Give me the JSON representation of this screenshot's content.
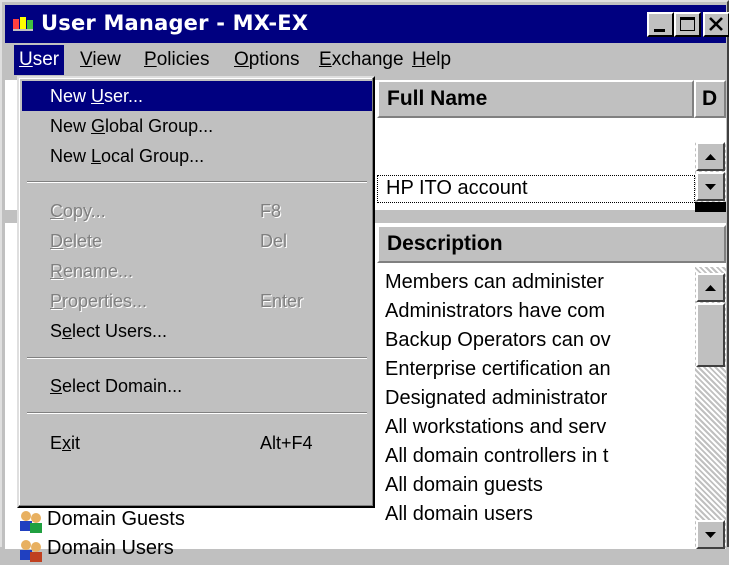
{
  "window": {
    "title": "User Manager - MX-EX"
  },
  "menubar": [
    {
      "label": "User",
      "mnemonic": "U",
      "rest": "ser"
    },
    {
      "label": "View",
      "mnemonic": "V",
      "rest": "iew"
    },
    {
      "label": "Policies",
      "mnemonic": "P",
      "rest": "olicies"
    },
    {
      "label": "Options",
      "mnemonic": "O",
      "rest": "ptions"
    },
    {
      "label": "Exchange",
      "mnemonic": "E",
      "rest": "xchange"
    },
    {
      "label": "Help",
      "mnemonic": "H",
      "rest": "elp"
    }
  ],
  "user_menu": {
    "new_user": {
      "pre": "New ",
      "mn": "U",
      "post": "ser..."
    },
    "new_global_group": {
      "pre": "New ",
      "mn": "G",
      "post": "lobal Group..."
    },
    "new_local_group": {
      "pre": "New ",
      "mn": "L",
      "post": "ocal Group..."
    },
    "copy": {
      "pre": "",
      "mn": "C",
      "post": "opy...",
      "shortcut": "F8"
    },
    "delete": {
      "pre": "",
      "mn": "D",
      "post": "elete",
      "shortcut": "Del"
    },
    "rename": {
      "pre": "",
      "mn": "R",
      "post": "ename..."
    },
    "properties": {
      "pre": "",
      "mn": "P",
      "post": "roperties...",
      "shortcut": "Enter"
    },
    "select_users": {
      "pre": "S",
      "mn": "e",
      "post": "lect Users..."
    },
    "select_domain": {
      "pre": "",
      "mn": "S",
      "post": "elect Domain..."
    },
    "exit": {
      "pre": "E",
      "mn": "x",
      "post": "it",
      "shortcut": "Alt+F4"
    }
  },
  "users_pane": {
    "column_full_name": "Full Name",
    "column_partial": "D",
    "rows": [
      "HP ITO account"
    ]
  },
  "groups_pane": {
    "column_description": "Description",
    "descriptions": [
      "Members can administer",
      "Administrators have com",
      "Backup Operators can ov",
      "Enterprise certification an",
      "Designated administrator",
      "All workstations and serv",
      "All domain controllers in t",
      "All domain guests",
      "All domain users"
    ],
    "visible_groups": [
      "Domain Guests",
      "Domain Users"
    ]
  }
}
